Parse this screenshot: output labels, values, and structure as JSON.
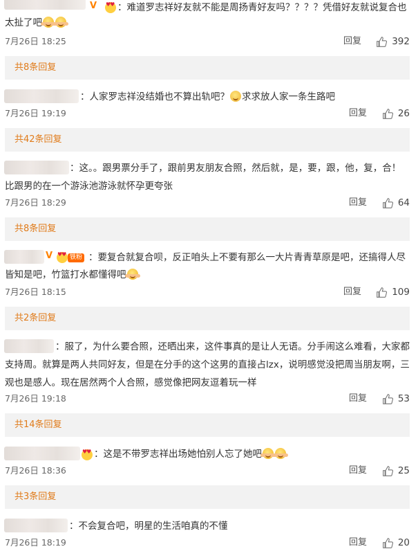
{
  "reply_label": "回复",
  "comments": [
    {
      "line1": "：难道罗志祥好友就不能是周扬青好友吗？？？？凭借好友就说复合也",
      "line2": "太扯了吧",
      "date": "7月26日 18:25",
      "likes": "392",
      "more": "共8条回复"
    },
    {
      "line1": "：人家罗志祥没结婚也不算出轨吧？",
      "line1b": "求求放人家一条生路吧",
      "date": "7月26日 19:19",
      "likes": "26",
      "more": "共42条回复"
    },
    {
      "line1": "：这。。跟男票分手了，跟前男友朋友合照，然后就，是，要，跟，他，复，合！",
      "line2": "比跟男的在一个游泳池游泳就怀孕更夸张",
      "date": "7月26日 18:29",
      "likes": "64",
      "more": "共8条回复"
    },
    {
      "badge": "铁粉",
      "line1": "：要复合就复合呗，反正咱头上不要有那么一大片青青草原是吧，还搞得人尽",
      "line2": "皆知是吧，竹篮打水都懂得吧",
      "date": "7月26日 18:15",
      "likes": "109",
      "more": "共2条回复"
    },
    {
      "line1": "：服了，为什么要合照，还晒出来，这件事真的是让人无语。分手闹这么难看，大家都",
      "line2": "支持周。就算是两人共同好友，但是在分手的这个这男的直接占lzx，说明感觉没把周当朋友啊，三",
      "line3": "观也是感人。现在居然两个人合照，感觉像把网友逗着玩一样",
      "date": "7月26日 19:18",
      "likes": "53",
      "more": "共14条回复"
    },
    {
      "line1": "：这是不带罗志祥出场她怕别人忘了她吧",
      "date": "7月26日 18:36",
      "likes": "25",
      "more": "共3条回复"
    },
    {
      "line1": "：不会复合吧，明星的生活咱真的不懂",
      "date": "7月26日 18:19",
      "likes": "20"
    }
  ]
}
